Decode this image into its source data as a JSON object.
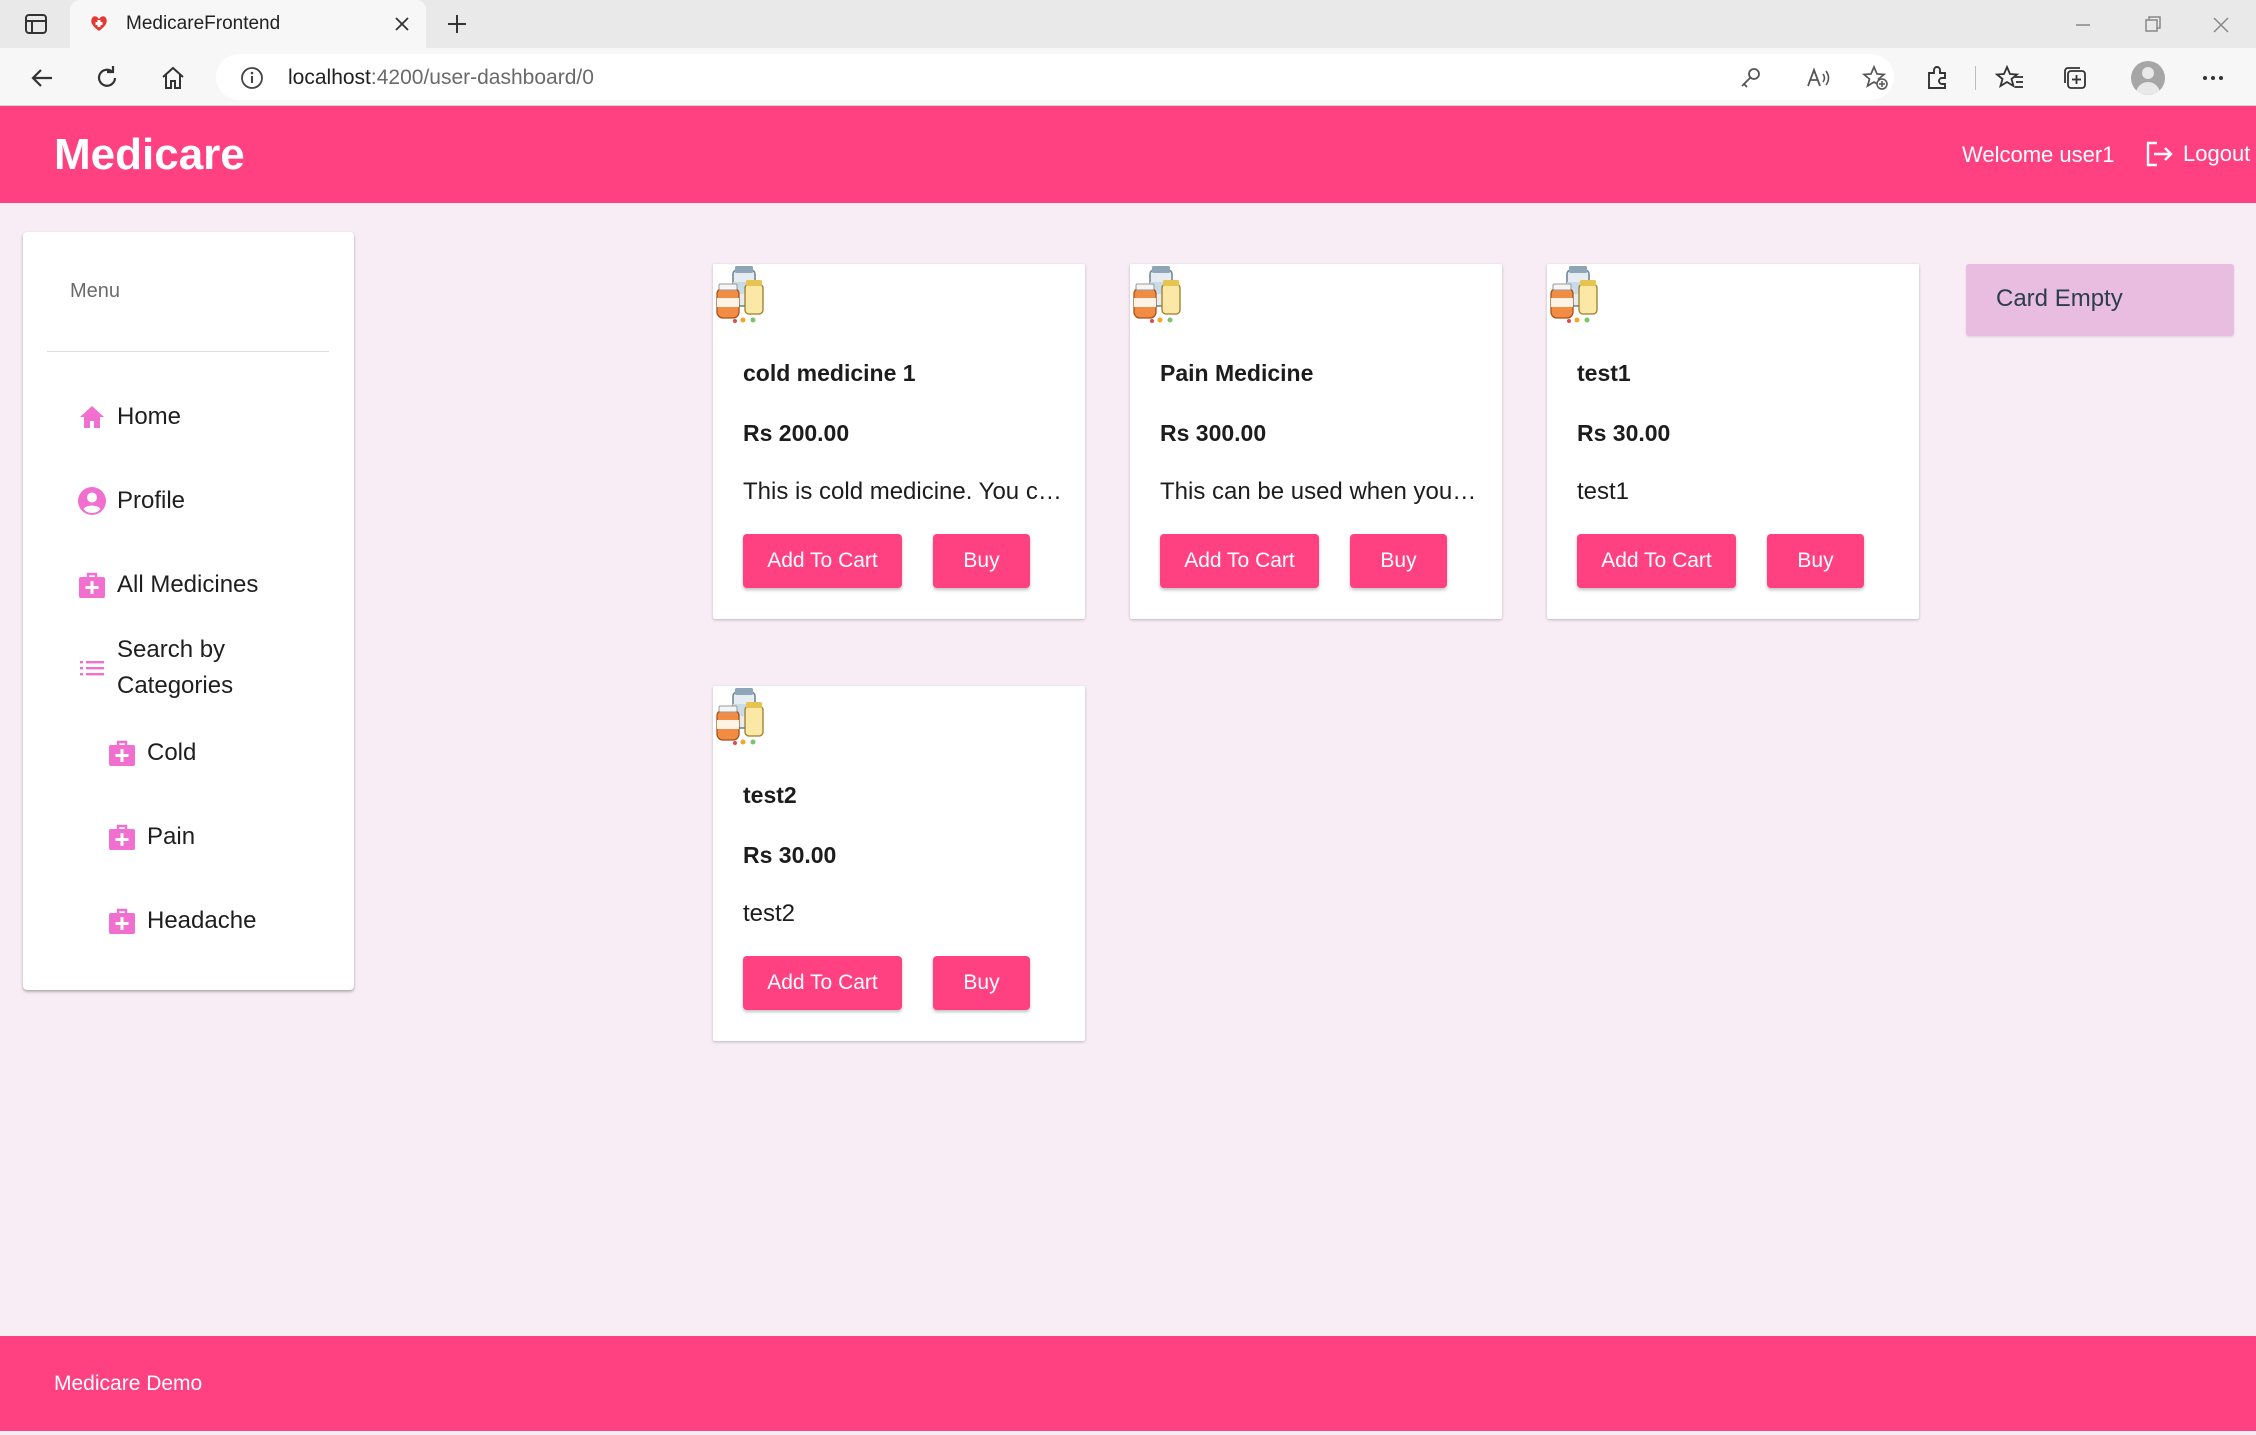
{
  "browser": {
    "tab_title": "MedicareFrontend",
    "url_host": "localhost",
    "url_path": ":4200/user-dashboard/0"
  },
  "header": {
    "brand": "Medicare",
    "welcome": "Welcome user1",
    "logout_label": "Logout"
  },
  "sidebar": {
    "title": "Menu",
    "items": [
      {
        "label": "Home",
        "icon": "home-icon"
      },
      {
        "label": "Profile",
        "icon": "account-circle-icon"
      },
      {
        "label": "All Medicines",
        "icon": "medical-bag-icon"
      },
      {
        "label": "Search by Categories",
        "icon": "list-icon"
      }
    ],
    "categories": [
      {
        "label": "Cold",
        "icon": "medical-bag-icon"
      },
      {
        "label": "Pain",
        "icon": "medical-bag-icon"
      },
      {
        "label": "Headache",
        "icon": "medical-bag-icon"
      }
    ]
  },
  "products": [
    {
      "name": "cold medicine 1",
      "price": "Rs 200.00",
      "description": "This is cold medicine. You can use it for cold",
      "add_label": "Add To Cart",
      "buy_label": "Buy"
    },
    {
      "name": "Pain Medicine",
      "price": "Rs 300.00",
      "description": "This can be used when you have pain",
      "add_label": "Add To Cart",
      "buy_label": "Buy"
    },
    {
      "name": "test1",
      "price": "Rs 30.00",
      "description": "test1",
      "add_label": "Add To Cart",
      "buy_label": "Buy"
    },
    {
      "name": "test2",
      "price": "Rs 30.00",
      "description": "test2",
      "add_label": "Add To Cart",
      "buy_label": "Buy"
    }
  ],
  "cart": {
    "status": "Card Empty"
  },
  "footer": {
    "text": "Medicare Demo"
  },
  "colors": {
    "primary": "#ff4081",
    "background": "#f8edf5",
    "icon_pink": "#f06fcf",
    "cart_badge": "#e8bde0"
  }
}
